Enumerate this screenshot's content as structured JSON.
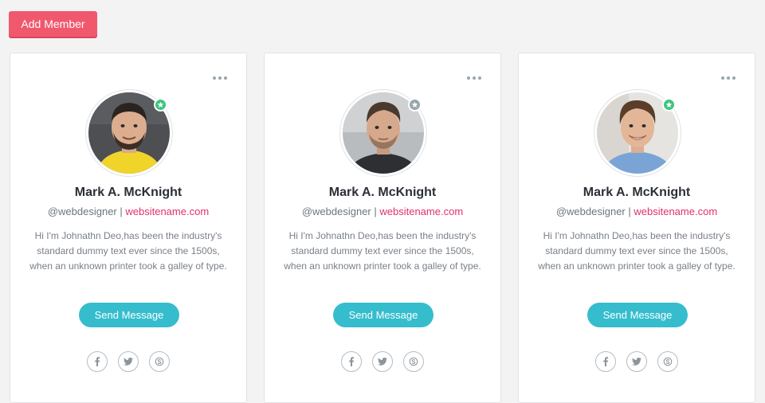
{
  "toolbar": {
    "add_label": "Add Member"
  },
  "members": [
    {
      "name": "Mark A. McKnight",
      "handle": "@webdesigner",
      "separator": " | ",
      "website": "websitename.com",
      "bio": "Hi I'm Johnathn Deo,has been the industry's standard dummy text ever since the 1500s, when an unknown printer took a galley of type.",
      "send_label": "Send Message",
      "status": "online",
      "status_color": "#3ec47e"
    },
    {
      "name": "Mark A. McKnight",
      "handle": "@webdesigner",
      "separator": " | ",
      "website": "websitename.com",
      "bio": "Hi I'm Johnathn Deo,has been the industry's standard dummy text ever since the 1500s, when an unknown printer took a galley of type.",
      "send_label": "Send Message",
      "status": "away",
      "status_color": "#98a6ad"
    },
    {
      "name": "Mark A. McKnight",
      "handle": "@webdesigner",
      "separator": " | ",
      "website": "websitename.com",
      "bio": "Hi I'm Johnathn Deo,has been the industry's standard dummy text ever since the 1500s, when an unknown printer took a galley of type.",
      "send_label": "Send Message",
      "status": "online",
      "status_color": "#3ec47e"
    }
  ],
  "social_icons": [
    "facebook-icon",
    "twitter-icon",
    "skype-icon"
  ],
  "colors": {
    "accent_button": "#f0586d",
    "send_button": "#35bdcd",
    "link": "#e1306c"
  }
}
